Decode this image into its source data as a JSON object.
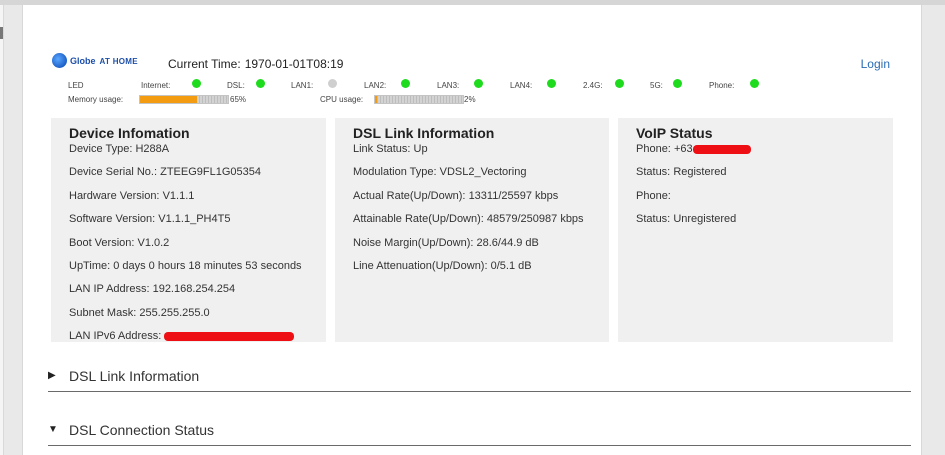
{
  "header": {
    "logo_text": "Globe",
    "logo_subtext": "AT HOME",
    "current_time_label": "Current Time:",
    "current_time_value": "1970-01-01T08:19",
    "login_label": "Login"
  },
  "led": {
    "label": "LED",
    "items": [
      {
        "label": "Internet:",
        "state": "on"
      },
      {
        "label": "DSL:",
        "state": "on"
      },
      {
        "label": "LAN1:",
        "state": "off"
      },
      {
        "label": "LAN2:",
        "state": "on"
      },
      {
        "label": "LAN3:",
        "state": "on"
      },
      {
        "label": "LAN4:",
        "state": "on"
      },
      {
        "label": "2.4G:",
        "state": "on"
      },
      {
        "label": "5G:",
        "state": "on"
      },
      {
        "label": "Phone:",
        "state": "on"
      }
    ],
    "on_color": "#1edb1e",
    "off_color": "#cfcfcf"
  },
  "usage": {
    "memory_label": "Memory usage:",
    "memory_value": "65%",
    "memory_fraction": 0.65,
    "cpu_label": "CPU usage:",
    "cpu_value": "2%",
    "cpu_fraction": 0.02,
    "fill_color": "#f39c12"
  },
  "device_panel": {
    "title": "Device Infomation",
    "rows": [
      {
        "key": "Device Type:",
        "value": "H288A"
      },
      {
        "key": "Device Serial No.:",
        "value": "ZTEEG9FL1G05354"
      },
      {
        "key": "Hardware Version:",
        "value": "V1.1.1"
      },
      {
        "key": "Software Version:",
        "value": "V1.1.1_PH4T5"
      },
      {
        "key": "Boot Version:",
        "value": "V1.0.2"
      },
      {
        "key": "UpTime:",
        "value": "0 days 0 hours 18 minutes 53 seconds"
      },
      {
        "key": "LAN IP Address:",
        "value": "192.168.254.254"
      },
      {
        "key": "Subnet Mask:",
        "value": "255.255.255.0"
      },
      {
        "key": "LAN IPv6 Address:",
        "value": ""
      }
    ]
  },
  "dsl_panel": {
    "title": "DSL Link Information",
    "rows": [
      {
        "key": "Link Status:",
        "value": "Up"
      },
      {
        "key": "Modulation Type:",
        "value": "VDSL2_Vectoring"
      },
      {
        "key": "Actual Rate(Up/Down):",
        "value": "13311/25597 kbps"
      },
      {
        "key": "Attainable Rate(Up/Down):",
        "value": "48579/250987 kbps"
      },
      {
        "key": "Noise Margin(Up/Down):",
        "value": "28.6/44.9 dB"
      },
      {
        "key": "Line Attenuation(Up/Down):",
        "value": "0/5.1 dB"
      }
    ]
  },
  "voip_panel": {
    "title": "VoIP Status",
    "rows": [
      {
        "key": "Phone:",
        "value": "+63"
      },
      {
        "key": "Status:",
        "value": "Registered"
      },
      {
        "key": "Phone:",
        "value": ""
      },
      {
        "key": "Status:",
        "value": "Unregistered"
      }
    ]
  },
  "sections": [
    {
      "label": "DSL Link Information",
      "arrow": "▶"
    },
    {
      "label": "DSL Connection Status",
      "arrow": "▼"
    }
  ],
  "redaction_color": "#ee0f14"
}
